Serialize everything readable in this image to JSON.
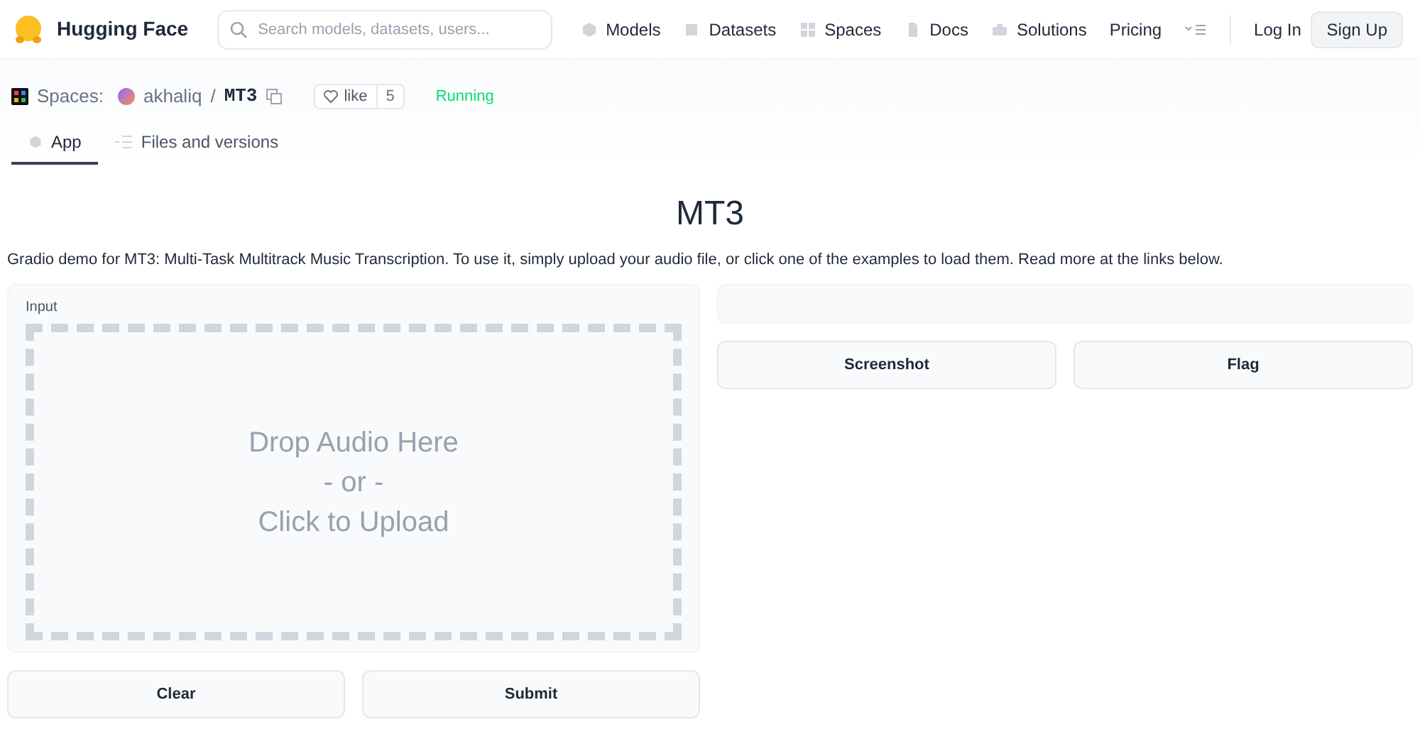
{
  "header": {
    "brand": "Hugging Face",
    "search": {
      "placeholder": "Search models, datasets, users..."
    },
    "nav": [
      {
        "label": "Models",
        "kind": "cube"
      },
      {
        "label": "Datasets",
        "kind": "table"
      },
      {
        "label": "Spaces",
        "kind": "grid"
      },
      {
        "label": "Docs",
        "kind": "doc"
      },
      {
        "label": "Solutions",
        "kind": "case"
      },
      {
        "label": "Pricing",
        "kind": "plain"
      }
    ],
    "login": "Log In",
    "signup": "Sign Up"
  },
  "space": {
    "prefix": "Spaces:",
    "owner": "akhaliq",
    "separator": "/",
    "name": "MT3",
    "like": "like",
    "likes": "5",
    "status": "Running",
    "tabs": [
      {
        "label": "App",
        "selected": true,
        "kind": "app"
      },
      {
        "label": "Files and versions",
        "selected": false,
        "kind": "files"
      }
    ]
  },
  "app": {
    "title": "MT3",
    "description": "Gradio demo for MT3: Multi-Task Multitrack Music Transcription. To use it, simply upload your audio file, or click one of the examples to load them. Read more at the links below.",
    "input": {
      "label": "Input",
      "drop": [
        "Drop Audio Here",
        "- or -",
        "Click to Upload"
      ]
    },
    "left_buttons": [
      "Clear",
      "Submit"
    ],
    "right_buttons": [
      "Screenshot",
      "Flag"
    ]
  }
}
